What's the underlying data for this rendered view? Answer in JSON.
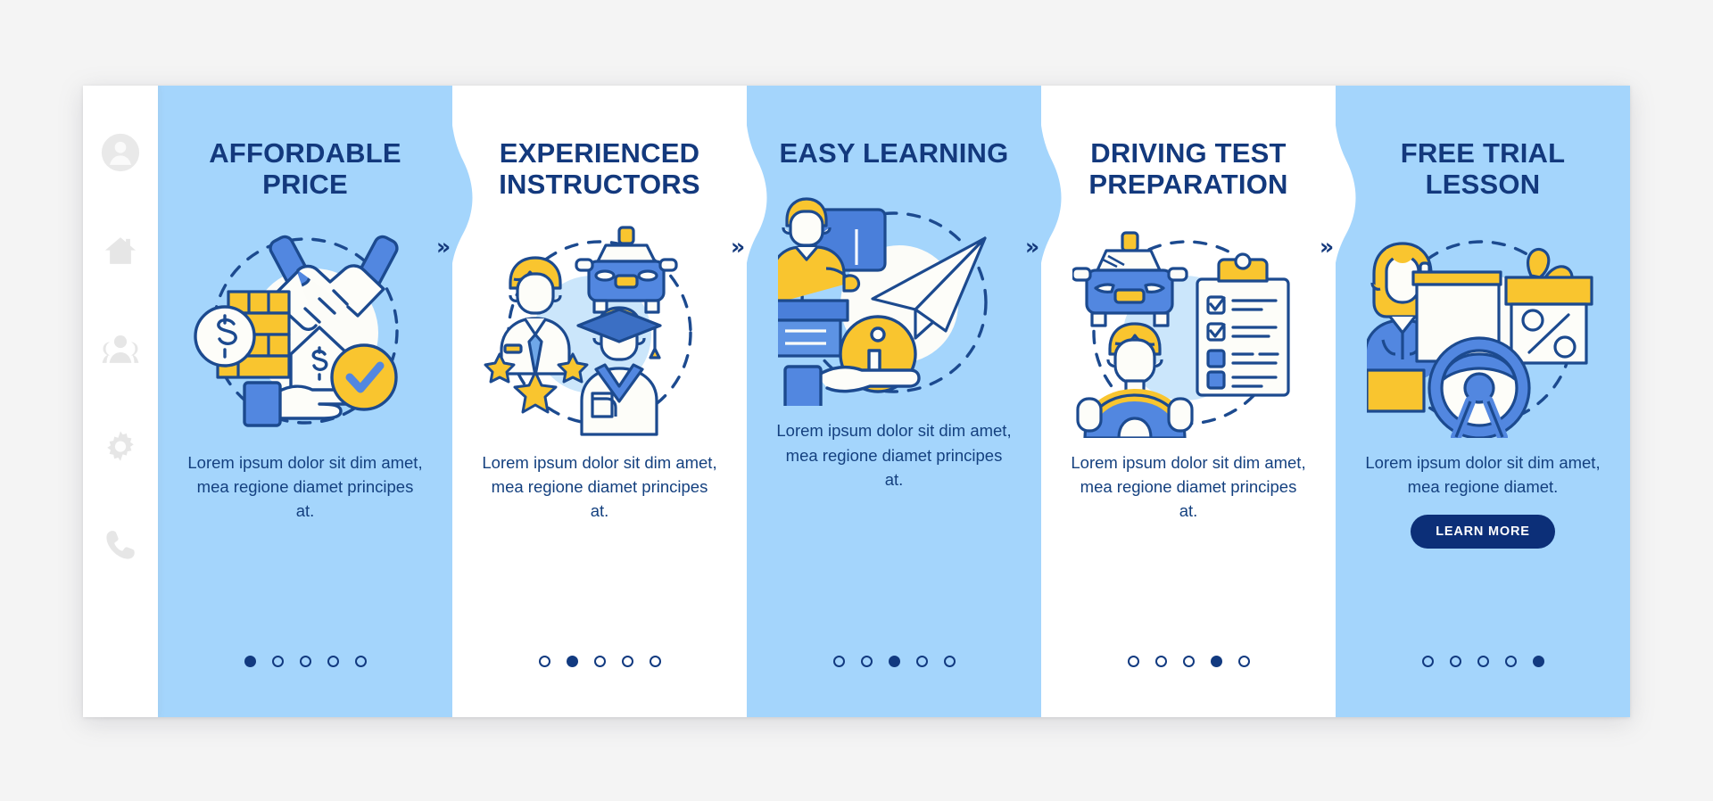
{
  "page": {
    "background_color": "#f4f4f4",
    "card_background": "#ffffff",
    "panel_blue": "#a4d5fc",
    "accent_navy": "#13397d",
    "accent_blue": "#4a83de",
    "accent_yellow": "#fbc72c",
    "button_color": "#0c2f78"
  },
  "sidebar": {
    "items": [
      {
        "icon": "user-icon",
        "label": "Profile"
      },
      {
        "icon": "home-icon",
        "label": "Home"
      },
      {
        "icon": "people-icon",
        "label": "Community"
      },
      {
        "icon": "gear-icon",
        "label": "Settings"
      },
      {
        "icon": "phone-icon",
        "label": "Contact"
      }
    ]
  },
  "separator": {
    "chevron": "»"
  },
  "panels": [
    {
      "id": "affordable-price",
      "title": "AFFORDABLE PRICE",
      "description": "Lorem ipsum dolor sit dim amet, mea regione diamet principes at.",
      "illustration": "handshake-money-illustration",
      "theme": "blue",
      "active_step": 1,
      "total_steps": 5,
      "button": null
    },
    {
      "id": "experienced-instructors",
      "title": "EXPERIENCED INSTRUCTORS",
      "description": "Lorem ipsum dolor sit dim amet, mea regione diamet principes at.",
      "illustration": "instructor-graduate-car-illustration",
      "theme": "white",
      "active_step": 2,
      "total_steps": 5,
      "button": null
    },
    {
      "id": "easy-learning",
      "title": "EASY LEARNING",
      "description": "Lorem ipsum dolor sit dim amet, mea regione diamet principes at.",
      "illustration": "teacher-paperplane-info-illustration",
      "theme": "blue",
      "active_step": 3,
      "total_steps": 5,
      "button": null
    },
    {
      "id": "driving-test-preparation",
      "title": "DRIVING TEST PREPARATION",
      "description": "Lorem ipsum dolor sit dim amet, mea regione diamet principes at.",
      "illustration": "car-driver-checklist-illustration",
      "theme": "white",
      "active_step": 4,
      "total_steps": 5,
      "button": null
    },
    {
      "id": "free-trial-lesson",
      "title": "FREE TRIAL LESSON",
      "description": "Lorem ipsum dolor sit dim amet, mea regione diamet.",
      "illustration": "teacher-gift-steeringwheel-illustration",
      "theme": "blue",
      "active_step": 5,
      "total_steps": 5,
      "button": "LEARN MORE"
    }
  ]
}
